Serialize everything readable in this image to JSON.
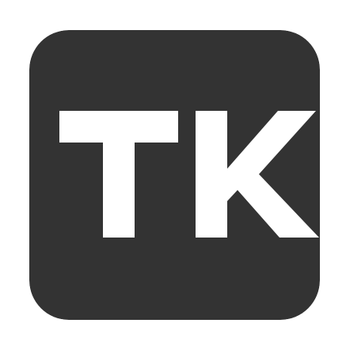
{
  "icon": {
    "name": "tk-app-icon",
    "logo_text": "TK",
    "colors": {
      "page_background": "#ffffff",
      "tile_background": "#333333",
      "glyph": "#ffffff"
    }
  }
}
